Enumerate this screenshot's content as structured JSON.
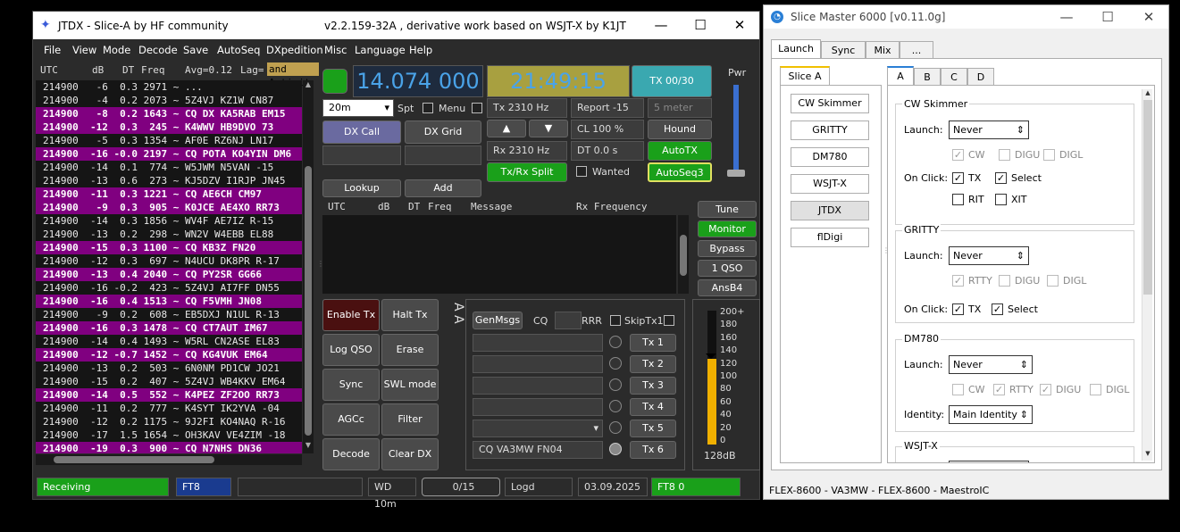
{
  "jtdx": {
    "title": "JTDX - Slice-A  by HF community",
    "version": "v2.2.159-32A , derivative work based on WSJT-X by K1JT",
    "menu": [
      "File",
      "View",
      "Mode",
      "Decode",
      "Save",
      "AutoSeq",
      "DXpedition",
      "Misc",
      "Language",
      "Help"
    ],
    "header": {
      "utc": "UTC",
      "db": "dB",
      "dt": "DT",
      "freq": "Freq",
      "avg": "Avg=0.12",
      "lag": "Lag=",
      "activity": "and Activit"
    },
    "rows": [
      {
        "t": "214900   -6  0.3 2971 ~ ...",
        "cq": false
      },
      {
        "t": "214900   -4  0.2 2073 ~ 5Z4VJ KZ1W CN87",
        "cq": false
      },
      {
        "t": "214900   -8  0.2 1643 ~ CQ DX KA5RAB EM15",
        "cq": true
      },
      {
        "t": "214900  -12  0.3  245 ~ K4WWV HB9DVO 73",
        "cq": true
      },
      {
        "t": "214900   -5  0.3 1354 ~ AF0E RZ6NJ LN17",
        "cq": false
      },
      {
        "t": "214900  -16 -0.0 2197 ~ CQ POTA KO4YIN DM6",
        "cq": true
      },
      {
        "t": "214900  -14  0.1  774 ~ W5JWM N5VAN -15",
        "cq": false
      },
      {
        "t": "214900  -13  0.6  273 ~ KJ5DZV I1RJP JN45",
        "cq": false
      },
      {
        "t": "214900  -11  0.3 1221 ~ CQ AE6CH CM97",
        "cq": true
      },
      {
        "t": "214900   -9  0.3  905 ~ K0JCE AE4XO RR73",
        "cq": true
      },
      {
        "t": "214900  -14  0.3 1856 ~ WV4F AE7IZ R-15",
        "cq": false
      },
      {
        "t": "214900  -13  0.2  298 ~ WN2V W4EBB EL88",
        "cq": false
      },
      {
        "t": "214900  -15  0.3 1100 ~ CQ KB3Z FN20",
        "cq": true
      },
      {
        "t": "214900  -12  0.3  697 ~ N4UCU DK8PR R-17",
        "cq": false
      },
      {
        "t": "214900  -13  0.4 2040 ~ CQ PY2SR GG66",
        "cq": true
      },
      {
        "t": "214900  -16 -0.2  423 ~ 5Z4VJ AI7FF DN55",
        "cq": false
      },
      {
        "t": "214900  -16  0.4 1513 ~ CQ F5VMH JN08",
        "cq": true
      },
      {
        "t": "214900   -9  0.2  608 ~ EB5DXJ N1UL R-13",
        "cq": false
      },
      {
        "t": "214900  -16  0.3 1478 ~ CQ CT7AUT IM67",
        "cq": true
      },
      {
        "t": "214900  -14  0.4 1493 ~ W5RL CN2ASE EL83",
        "cq": false
      },
      {
        "t": "214900  -12 -0.7 1452 ~ CQ KG4VUK EM64",
        "cq": true
      },
      {
        "t": "214900  -13  0.2  503 ~ 6N0NM PD1CW JO21",
        "cq": false
      },
      {
        "t": "214900  -15  0.2  407 ~ 5Z4VJ WB4KKV EM64",
        "cq": false
      },
      {
        "t": "214900  -14  0.5  552 ~ K4PEZ ZF2OO RR73",
        "cq": true
      },
      {
        "t": "214900  -11  0.2  777 ~ K4SYT IK2YVA -04",
        "cq": false
      },
      {
        "t": "214900  -12  0.2 1175 ~ 9J2FI KO4NAQ R-16",
        "cq": false
      },
      {
        "t": "214900  -17  1.5 1654 ~ OH3KAV VE4ZIM -18",
        "cq": false
      },
      {
        "t": "214900  -19  0.3  900 ~ CQ N7NHS DN36",
        "cq": true
      }
    ],
    "dial_freq": "14.074 000",
    "clock": "21:49:15",
    "tx_counter": "TX 00/30",
    "pwr": "Pwr",
    "band": "20m",
    "spt": "Spt",
    "menu_cb": "Menu",
    "tx_hz": "Tx  2310  Hz",
    "rx_hz": "Rx  2310  Hz",
    "report": "Report -15",
    "smeter": "5 meter",
    "cl": "CL  100 %",
    "dt": "DT 0.0 s",
    "hound": "Hound",
    "autotx": "AutoTX",
    "txrx_split": "Tx/Rx Split",
    "wanted": "Wanted",
    "autoseq": "AutoSeq3",
    "dxcall": "DX Call",
    "dxgrid": "DX Grid",
    "lookup": "Lookup",
    "add": "Add",
    "rx_header": {
      "utc": "UTC",
      "db": "dB",
      "dt": "DT",
      "freq": "Freq",
      "msg": "Message",
      "rxf": "Rx Frequency"
    },
    "right_buttons": [
      "Tune",
      "Monitor",
      "Bypass",
      "1 QSO",
      "AnsB4"
    ],
    "left_grid": [
      "Enable Tx",
      "Halt Tx",
      "Log QSO",
      "Erase",
      "Sync",
      "SWL mode",
      "AGCc",
      "Filter",
      "Decode",
      "Clear DX"
    ],
    "genmsgs": "GenMsgs",
    "cq": "CQ",
    "rrr": "RRR",
    "skiptx1": "SkipTx1",
    "tx_buttons": [
      "Tx 1",
      "Tx 2",
      "Tx 3",
      "Tx 4",
      "Tx 5",
      "Tx 6"
    ],
    "tx6_msg": "CQ VA3MW FN04",
    "aa": "A A",
    "meter_ticks": [
      "200+",
      "180",
      "160",
      "140",
      "120",
      "100",
      "80",
      "60",
      "40",
      "20",
      "0"
    ],
    "meter_db": "128dB",
    "status": {
      "receiving": "Receiving",
      "mode": "FT8",
      "wd": "WD 10m",
      "count": "0/15",
      "logd": "Logd",
      "date": "03.09.2025",
      "ft8": "FT8  0"
    }
  },
  "slicemaster": {
    "title": "Slice Master 6000 [v0.11.0g]",
    "tabs": [
      "Launch",
      "Sync",
      "Mix",
      "..."
    ],
    "slice_tab": "Slice A",
    "apps": [
      "CW Skimmer",
      "GRITTY",
      "DM780",
      "WSJT-X",
      "JTDX",
      "flDigi"
    ],
    "subtabs": [
      "A",
      "B",
      "C",
      "D"
    ],
    "cw": {
      "title": "CW Skimmer",
      "launch": "Launch:",
      "never": "Never",
      "cw": "CW",
      "digu": "DIGU",
      "digl": "DIGL",
      "onclick": "On Click:",
      "tx": "TX",
      "select": "Select",
      "rit": "RIT",
      "xit": "XIT"
    },
    "gritty": {
      "title": "GRITTY",
      "launch": "Launch:",
      "never": "Never",
      "rtty": "RTTY",
      "digu": "DIGU",
      "digl": "DIGL",
      "onclick": "On Click:",
      "tx": "TX",
      "select": "Select"
    },
    "dm": {
      "title": "DM780",
      "launch": "Launch:",
      "never": "Never",
      "cw": "CW",
      "rtty": "RTTY",
      "digu": "DIGU",
      "digl": "DIGL",
      "identity": "Identity:",
      "identity_val": "Main Identity"
    },
    "wsjt": {
      "title": "WSJT-X"
    },
    "status": "FLEX-8600 - VA3MW - FLEX-8600 - MaestroIC"
  }
}
